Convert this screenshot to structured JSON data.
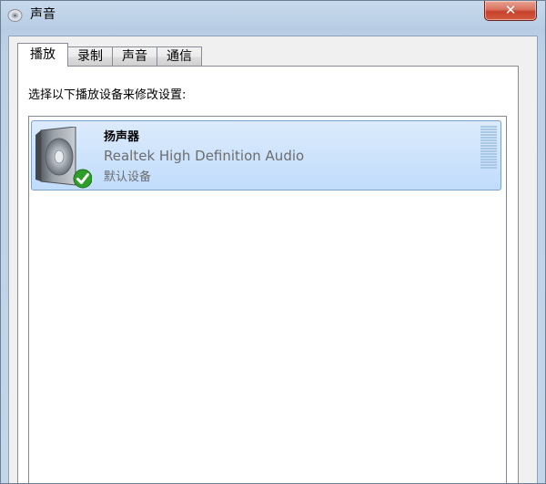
{
  "window": {
    "title": "声音",
    "close_label": "✕"
  },
  "tabs": [
    {
      "label": "播放",
      "active": true
    },
    {
      "label": "录制",
      "active": false
    },
    {
      "label": "声音",
      "active": false
    },
    {
      "label": "通信",
      "active": false
    }
  ],
  "panel": {
    "instruction": "选择以下播放设备来修改设置:"
  },
  "devices": [
    {
      "name": "扬声器",
      "description": "Realtek High Definition Audio",
      "status": "默认设备",
      "icon": "speaker-icon",
      "default_badge_icon": "checkmark-icon",
      "selected": true
    }
  ],
  "colors": {
    "selection_bg": "#c8e0fc",
    "selection_border": "#7da2ce",
    "close_button": "#c7422c",
    "secondary_text": "#6d6d6d"
  }
}
